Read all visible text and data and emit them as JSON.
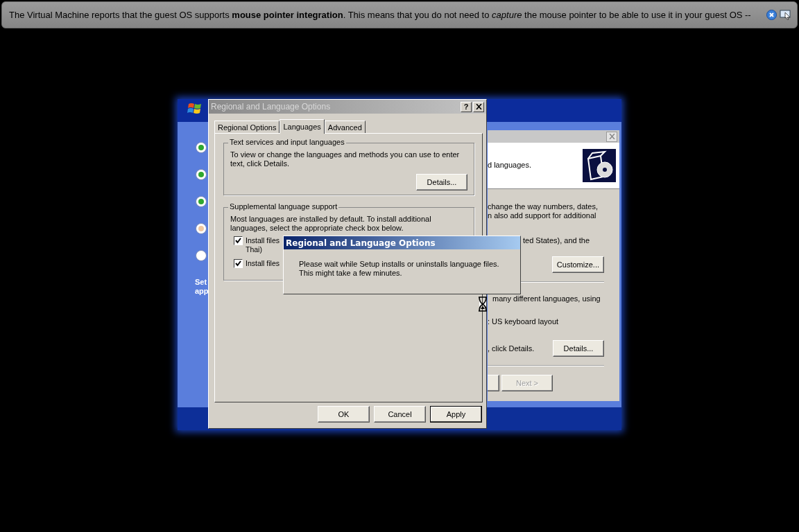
{
  "notification": {
    "text": "The Virtual Machine reports that the guest OS supports **mouse pointer integration**. This means that you do not need to *capture* the mouse pointer to be able to use it in your guest OS --"
  },
  "setup_screen": {
    "steps": [
      {
        "completed": true,
        "current": false
      },
      {
        "completed": true,
        "current": false
      },
      {
        "completed": true,
        "current": false
      },
      {
        "completed": false,
        "current": true
      },
      {
        "completed": false,
        "current": false
      }
    ],
    "sidebar_text": "Set\napp"
  },
  "setup_page": {
    "header_text": "d languages.",
    "intro_text": "change the way numbers, dates,\nn also add support for additional",
    "locale_text": "ted States), and the",
    "customize_button": "Customize...",
    "languages_text": "many different languages, using",
    "keyboard_text": ": US keyboard layout",
    "details_text": ", click Details.",
    "details_button": "Details...",
    "next_button": {
      "label": "Next >",
      "disabled": true
    }
  },
  "dialog": {
    "title": "Regional and Language Options",
    "help_button": "?",
    "tabs": [
      {
        "label": "Regional Options",
        "selected": false
      },
      {
        "label": "Languages",
        "selected": true
      },
      {
        "label": "Advanced",
        "selected": false
      }
    ],
    "text_services": {
      "legend": "Text services and input languages",
      "description": "To view or change the languages and methods you can use to enter text, click Details.",
      "button": "Details..."
    },
    "supplemental": {
      "legend": "Supplemental language support",
      "description": "Most languages are installed by default. To install additional languages, select the appropriate check box below.",
      "options": [
        {
          "label": "Install files\nThai)",
          "checked": true
        },
        {
          "label": "Install files",
          "checked": true
        }
      ]
    },
    "buttons": [
      {
        "label": "OK",
        "default": false
      },
      {
        "label": "Cancel",
        "default": false
      },
      {
        "label": "Apply",
        "default": true
      }
    ]
  },
  "progress_dialog": {
    "title": "Regional and Language Options",
    "message": "Please wait while Setup installs or uninstalls language files. This might take a few minutes."
  }
}
